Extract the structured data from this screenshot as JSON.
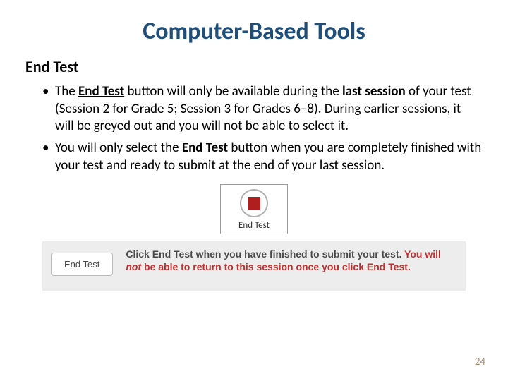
{
  "title": "Computer-Based Tools",
  "subtitle": "End Test",
  "bullet1": {
    "a": "The ",
    "b": "End Test",
    "c": " button will only be available during the ",
    "d": "last session",
    "e": " of your test (Session 2 for Grade 5; Session 3 for Grades 6–8). During earlier sessions, it will be greyed out and you will not be able to select it."
  },
  "bullet2": {
    "a": "You will only select the ",
    "b": "End Test",
    "c": " button when you are completely finished with your test and ready to submit at the end of your last session."
  },
  "endtest_box_label": "End Test",
  "endtest_button_label": "End Test",
  "instr": {
    "a": "Click End Test when you have finished to submit your test. ",
    "b": "You will ",
    "c": "not",
    "d": " be able to return to this session once you click End Test."
  },
  "page_number": "24"
}
